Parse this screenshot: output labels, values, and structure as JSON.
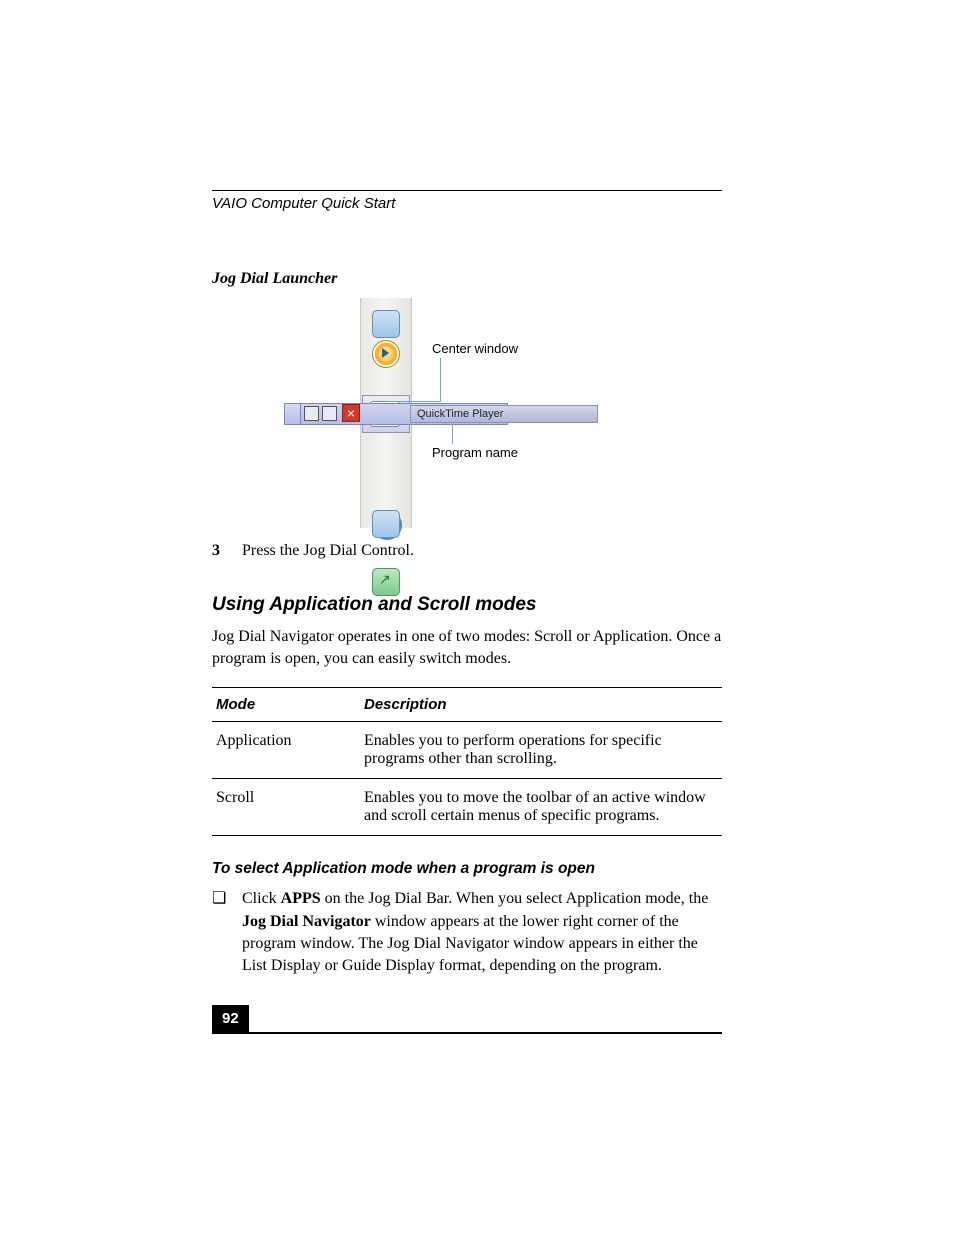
{
  "running_head": "VAIO Computer Quick Start",
  "figure_caption": "Jog Dial Launcher",
  "figure": {
    "callout_center": "Center window",
    "callout_program": "Program name",
    "selected_program": "QuickTime Player"
  },
  "step": {
    "num": "3",
    "text": "Press the Jog Dial Control."
  },
  "section_heading": "Using Application and Scroll modes",
  "intro_para": "Jog Dial Navigator operates in one of two modes: Scroll or Application. Once a program is open, you can easily switch modes.",
  "table": {
    "head_mode": "Mode",
    "head_desc": "Description",
    "rows": [
      {
        "mode": "Application",
        "desc": "Enables you to perform operations for specific programs other than scrolling."
      },
      {
        "mode": "Scroll",
        "desc": "Enables you to move the toolbar of an active window and scroll certain menus of specific programs."
      }
    ]
  },
  "sub_heading": "To select Application mode when a program is open",
  "bullet": {
    "pre": "Click ",
    "bold1": "APPS",
    "mid1": " on the Jog Dial Bar. When you select Application mode, the ",
    "bold2": "Jog Dial Navigator",
    "post": " window appears at the lower right corner of the program window. The Jog Dial Navigator window appears in either the List Display or Guide Display format, depending on the program."
  },
  "page_number": "92"
}
